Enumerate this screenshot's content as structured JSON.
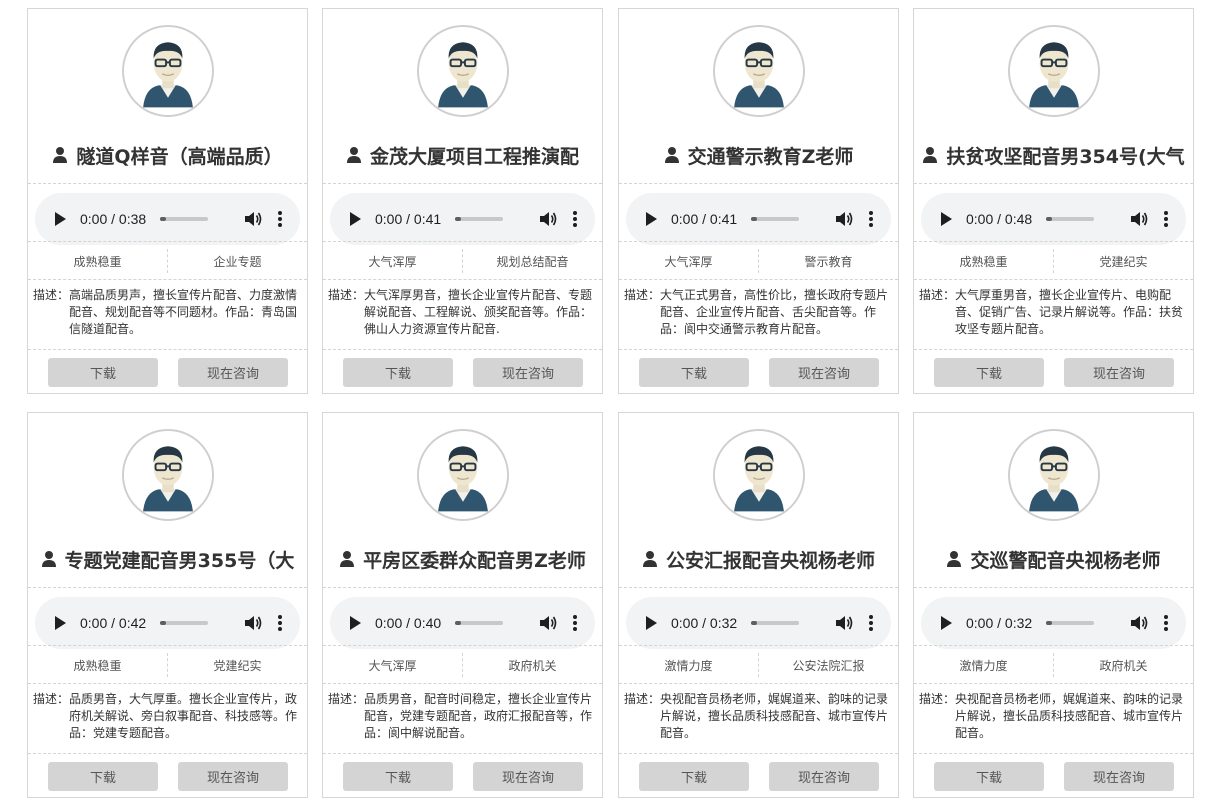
{
  "cards": [
    {
      "title": "隧道Q样音（高端品质）",
      "time": "0:00 / 0:38",
      "tag1": "成熟稳重",
      "tag2": "企业专题",
      "desc_label": "描述：",
      "desc": "高端品质男声，擅长宣传片配音、力度激情配音、规划配音等不同题材。作品：青岛国信隧道配音。",
      "download_label": "下载",
      "consult_label": "现在咨询"
    },
    {
      "title": "金茂大厦项目工程推演配",
      "time": "0:00 / 0:41",
      "tag1": "大气浑厚",
      "tag2": "规划总结配音",
      "desc_label": "描述：",
      "desc": "大气浑厚男音，擅长企业宣传片配音、专题解说配音、工程解说、颁奖配音等。作品：佛山人力资源宣传片配音.",
      "download_label": "下载",
      "consult_label": "现在咨询"
    },
    {
      "title": "交通警示教育Z老师",
      "time": "0:00 / 0:41",
      "tag1": "大气浑厚",
      "tag2": "警示教育",
      "desc_label": "描述：",
      "desc": "大气正式男音，高性价比，擅长政府专题片配音、企业宣传片配音、舌尖配音等。作品：阆中交通警示教育片配音。",
      "download_label": "下载",
      "consult_label": "现在咨询"
    },
    {
      "title": "扶贫攻坚配音男354号(大气",
      "time": "0:00 / 0:48",
      "tag1": "成熟稳重",
      "tag2": "党建纪实",
      "desc_label": "描述：",
      "desc": "大气厚重男音，擅长企业宣传片、电购配音、促销广告、记录片解说等。作品：扶贫攻坚专题片配音。",
      "download_label": "下载",
      "consult_label": "现在咨询"
    },
    {
      "title": "专题党建配音男355号（大",
      "time": "0:00 / 0:42",
      "tag1": "成熟稳重",
      "tag2": "党建纪实",
      "desc_label": "描述：",
      "desc": "品质男音，大气厚重。擅长企业宣传片，政府机关解说、旁白叙事配音、科技感等。作品：党建专题配音。",
      "download_label": "下载",
      "consult_label": "现在咨询"
    },
    {
      "title": "平房区委群众配音男Z老师",
      "time": "0:00 / 0:40",
      "tag1": "大气浑厚",
      "tag2": "政府机关",
      "desc_label": "描述：",
      "desc": "品质男音，配音时间稳定，擅长企业宣传片配音，党建专题配音，政府汇报配音等，作品：阆中解说配音。",
      "download_label": "下载",
      "consult_label": "现在咨询"
    },
    {
      "title": "公安汇报配音央视杨老师",
      "time": "0:00 / 0:32",
      "tag1": "激情力度",
      "tag2": "公安法院汇报",
      "desc_label": "描述：",
      "desc": "央视配音员杨老师，娓娓道来、韵味的记录片解说，擅长品质科技感配音、城市宣传片配音。",
      "download_label": "下载",
      "consult_label": "现在咨询"
    },
    {
      "title": "交巡警配音央视杨老师",
      "time": "0:00 / 0:32",
      "tag1": "激情力度",
      "tag2": "政府机关",
      "desc_label": "描述：",
      "desc": "央视配音员杨老师，娓娓道来、韵味的记录片解说，擅长品质科技感配音、城市宣传片配音。",
      "download_label": "下载",
      "consult_label": "现在咨询"
    }
  ],
  "icons": {
    "title_icon": "person-icon",
    "avatar": "avatar-icon",
    "play": "play-icon",
    "volume": "volume-icon",
    "more": "more-options-icon"
  }
}
